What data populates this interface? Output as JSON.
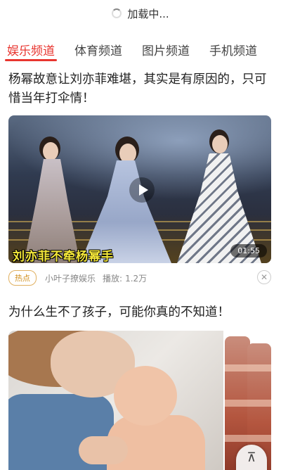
{
  "status": {
    "loading_text": "加载中..."
  },
  "tabs": [
    {
      "label": "娱乐频道",
      "active": true
    },
    {
      "label": "体育频道",
      "active": false
    },
    {
      "label": "图片频道",
      "active": false
    },
    {
      "label": "手机频道",
      "active": false
    }
  ],
  "feed": {
    "article_1": {
      "title": "杨幂故意让刘亦菲难堪，其实是有原因的，只可惜当年打伞情！",
      "video_caption": "刘亦菲不牵杨幂手",
      "duration": "01:55",
      "badge": "热点",
      "source": "小叶子撩娱乐",
      "plays_label": "播放:",
      "plays": "1.2万"
    },
    "article_2": {
      "title": "为什么生不了孩子，可能你真的不知道！"
    }
  },
  "colors": {
    "accent": "#e8352f",
    "badge": "#d19020",
    "caption": "#f5e83a"
  },
  "icons": {
    "loading": "spinner-icon",
    "play": "play-icon",
    "dismiss": "close-icon",
    "scroll_top": "arrow-up-icon"
  }
}
